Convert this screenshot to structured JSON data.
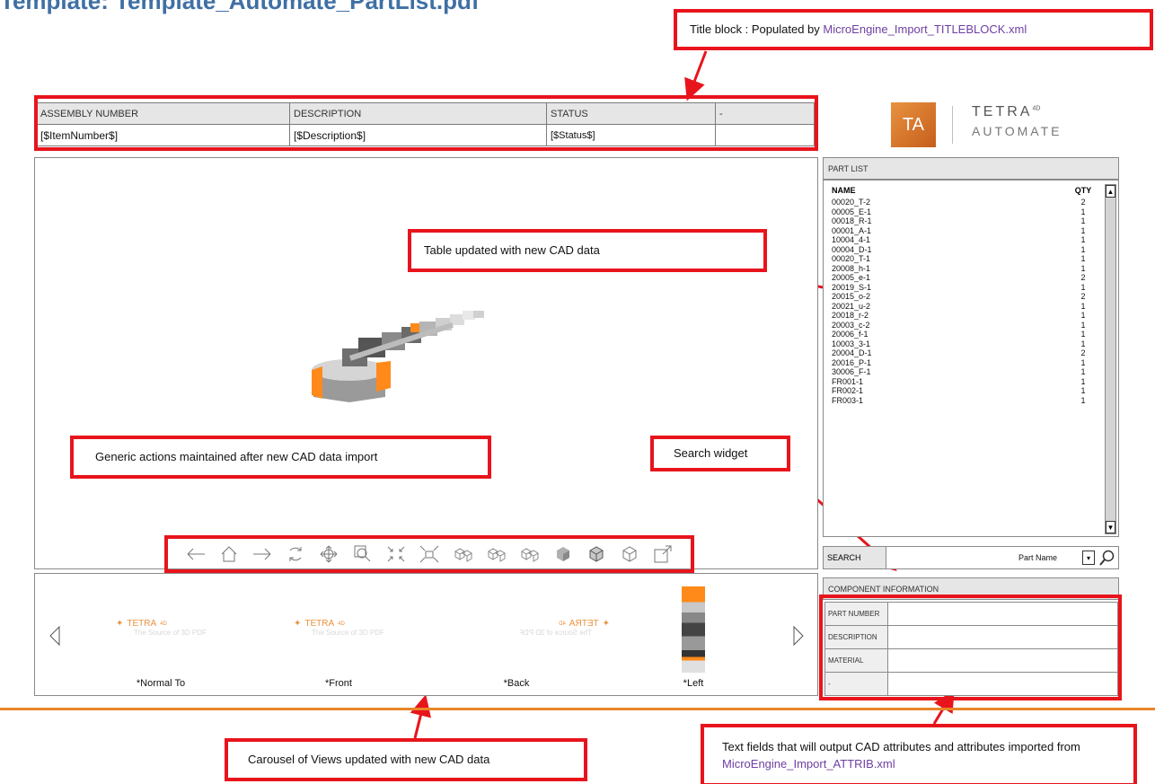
{
  "page_heading": "Template: Template_Automate_PartList.pdf",
  "callouts": {
    "title_block_prefix": "Title block : Populated by ",
    "title_block_link": "MicroEngine_Import_TITLEBLOCK.xml",
    "table_updated": "Table updated with new CAD data",
    "generic_actions": "Generic actions maintained after new CAD data import",
    "search_widget": "Search widget",
    "carousel_updated": "Carousel of Views updated with new CAD data",
    "text_fields_prefix": "Text fields that will output CAD attributes and attributes imported from ",
    "text_fields_link": "MicroEngine_Import_ATTRIB.xml"
  },
  "title_block": {
    "headers": [
      "ASSEMBLY NUMBER",
      "DESCRIPTION",
      "STATUS",
      "-"
    ],
    "values": [
      "[$ItemNumber$]",
      "[$Description$]",
      "[$Status$]",
      ""
    ]
  },
  "logo": {
    "mark": "TA",
    "word1": "TETRA",
    "word1_sup": "4D",
    "word2": "AUTOMATE"
  },
  "toolbar_icons": [
    "back-arrow-icon",
    "home-icon",
    "forward-arrow-icon",
    "rotate-icon",
    "pan-icon",
    "zoom-window-icon",
    "fit-all-icon",
    "explode-icon",
    "view-cube-1-icon",
    "view-cube-2-icon",
    "view-cube-3-icon",
    "shaded-icon",
    "shaded-edges-icon",
    "wireframe-icon",
    "fullscreen-icon"
  ],
  "carousel": {
    "brand": "TETRA",
    "brand_sup": "4D",
    "brand_sub": "The Source of 3D PDF",
    "labels": [
      "*Normal To",
      "*Front",
      "*Back",
      "*Left"
    ]
  },
  "part_list": {
    "header": "PART LIST",
    "col_name": "NAME",
    "col_qty": "QTY",
    "rows": [
      {
        "name": "00020_T-2",
        "qty": "2"
      },
      {
        "name": "00005_E-1",
        "qty": "1"
      },
      {
        "name": "00018_R-1",
        "qty": "1"
      },
      {
        "name": "00001_A-1",
        "qty": "1"
      },
      {
        "name": "10004_4-1",
        "qty": "1"
      },
      {
        "name": "00004_D-1",
        "qty": "1"
      },
      {
        "name": "00020_T-1",
        "qty": "1"
      },
      {
        "name": "20008_h-1",
        "qty": "1"
      },
      {
        "name": "20005_e-1",
        "qty": "2"
      },
      {
        "name": "20019_S-1",
        "qty": "1"
      },
      {
        "name": "20015_o-2",
        "qty": "2"
      },
      {
        "name": "20021_u-2",
        "qty": "1"
      },
      {
        "name": "20018_r-2",
        "qty": "1"
      },
      {
        "name": "20003_c-2",
        "qty": "1"
      },
      {
        "name": "20006_f-1",
        "qty": "1"
      },
      {
        "name": "10003_3-1",
        "qty": "1"
      },
      {
        "name": "20004_D-1",
        "qty": "2"
      },
      {
        "name": "20016_P-1",
        "qty": "1"
      },
      {
        "name": "30006_F-1",
        "qty": "1"
      },
      {
        "name": "FR001-1",
        "qty": "1"
      },
      {
        "name": "FR002-1",
        "qty": "1"
      },
      {
        "name": "FR003-1",
        "qty": "1"
      }
    ]
  },
  "search": {
    "label": "SEARCH",
    "value": "Part Name"
  },
  "component_info": {
    "header": "COMPONENT INFORMATION",
    "fields": [
      "PART NUMBER",
      "DESCRIPTION",
      "MATERIAL",
      "-"
    ]
  },
  "colors": {
    "callout_red": "#e8141c",
    "brand_orange": "#e8862a",
    "heading_blue": "#3f6fa4",
    "link_purple": "#6e3fa3"
  }
}
